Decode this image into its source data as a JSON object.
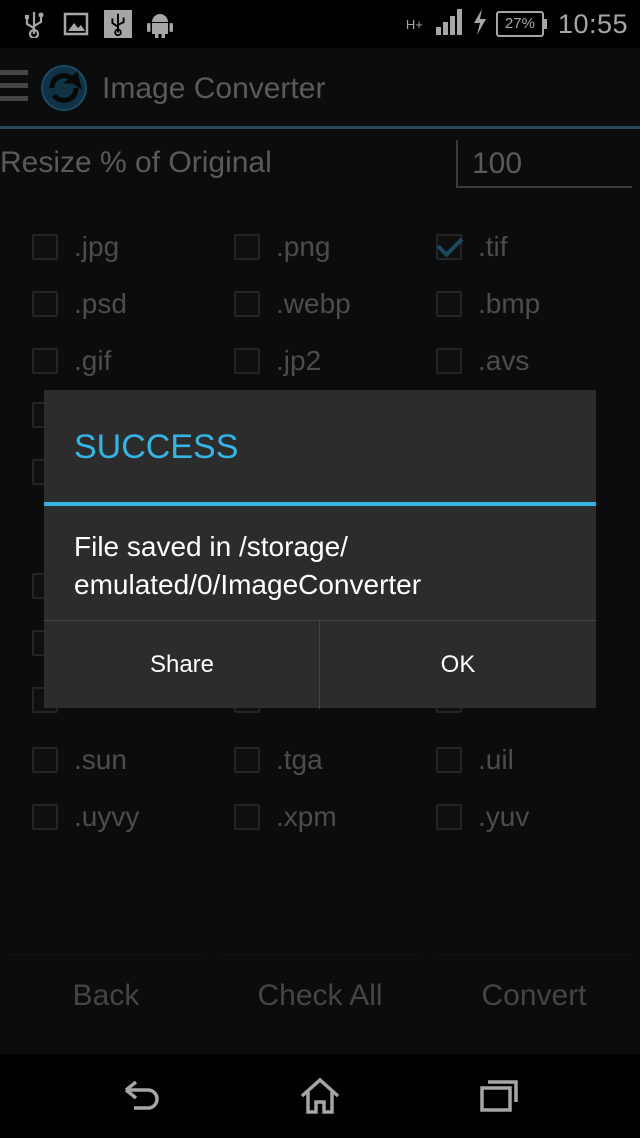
{
  "status_bar": {
    "time": "10:55",
    "battery": "27%",
    "network": "H+",
    "icons": [
      "usb-icon",
      "image-icon",
      "usb-debug-icon",
      "android-icon",
      "signal-icon",
      "charging-icon"
    ]
  },
  "app_bar": {
    "title": "Image Converter"
  },
  "resize": {
    "label": "Resize % of Original",
    "value": "100"
  },
  "formats": [
    {
      "label": ".jpg",
      "checked": false
    },
    {
      "label": ".png",
      "checked": false
    },
    {
      "label": ".tif",
      "checked": true
    },
    {
      "label": ".psd",
      "checked": false
    },
    {
      "label": ".webp",
      "checked": false
    },
    {
      "label": ".bmp",
      "checked": false
    },
    {
      "label": ".gif",
      "checked": false
    },
    {
      "label": ".jp2",
      "checked": false
    },
    {
      "label": ".avs",
      "checked": false
    },
    {
      "label": ".sun",
      "checked": false
    },
    {
      "label": ".tga",
      "checked": false
    },
    {
      "label": ".uil",
      "checked": false
    },
    {
      "label": ".uyvy",
      "checked": false
    },
    {
      "label": ".xpm",
      "checked": false
    },
    {
      "label": ".yuv",
      "checked": false
    }
  ],
  "buttons": {
    "back": "Back",
    "check_all": "Check All",
    "convert": "Convert"
  },
  "dialog": {
    "title": "SUCCESS",
    "message": "File saved in /storage/\nemulated/0/ImageConverter",
    "share": "Share",
    "ok": "OK"
  },
  "colors": {
    "accent": "#33b5e5",
    "dialog_bg": "#2c2c2c",
    "check": "#2e6f93"
  }
}
